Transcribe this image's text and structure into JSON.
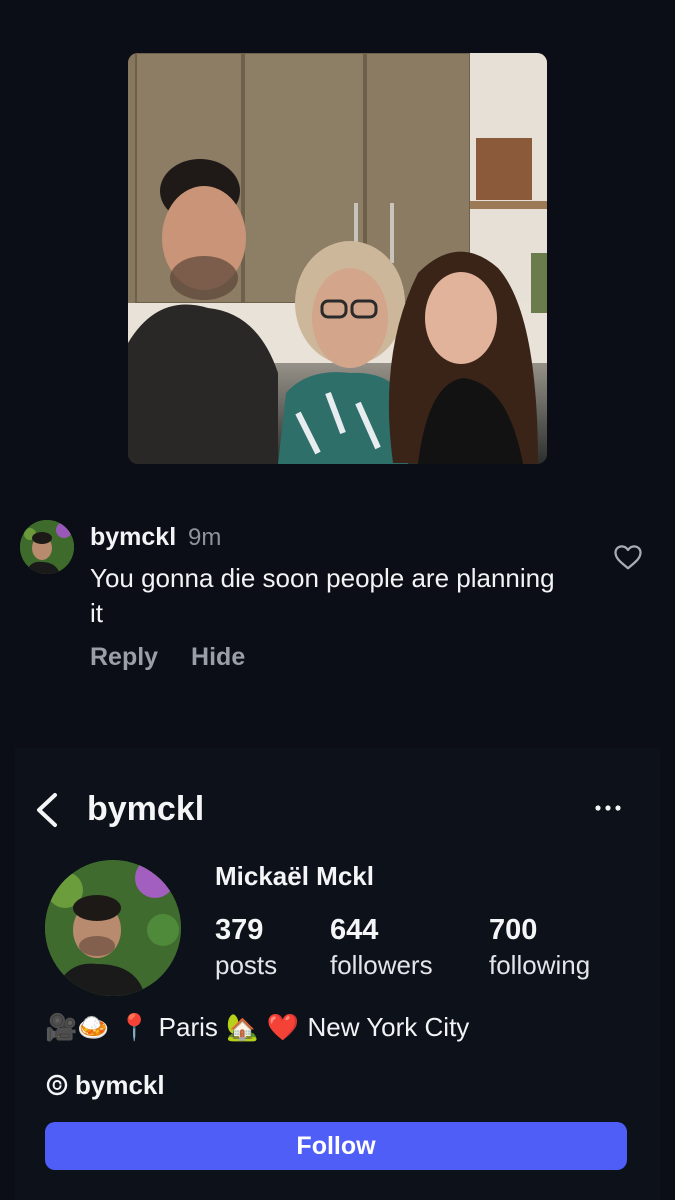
{
  "comment": {
    "username": "bymckl",
    "time": "9m",
    "text": "You gonna die soon people are planning it",
    "actions": {
      "reply": "Reply",
      "hide": "Hide"
    }
  },
  "profile": {
    "username": "bymckl",
    "display_name": "Mickaël Mckl",
    "stats": {
      "posts": {
        "value": "379",
        "label": "posts"
      },
      "followers": {
        "value": "644",
        "label": "followers"
      },
      "following": {
        "value": "700",
        "label": "following"
      }
    },
    "bio": {
      "emojis_start": "🎥🍛",
      "pin": "📍",
      "city1": "Paris",
      "house": "🏡",
      "heart": "❤️",
      "city2": "New York City"
    },
    "threads_handle": "bymckl",
    "follow_label": "Follow"
  },
  "colors": {
    "background": "#0b0e16",
    "follow_button": "#4f5ef7",
    "muted_text": "#9a9ea7"
  }
}
